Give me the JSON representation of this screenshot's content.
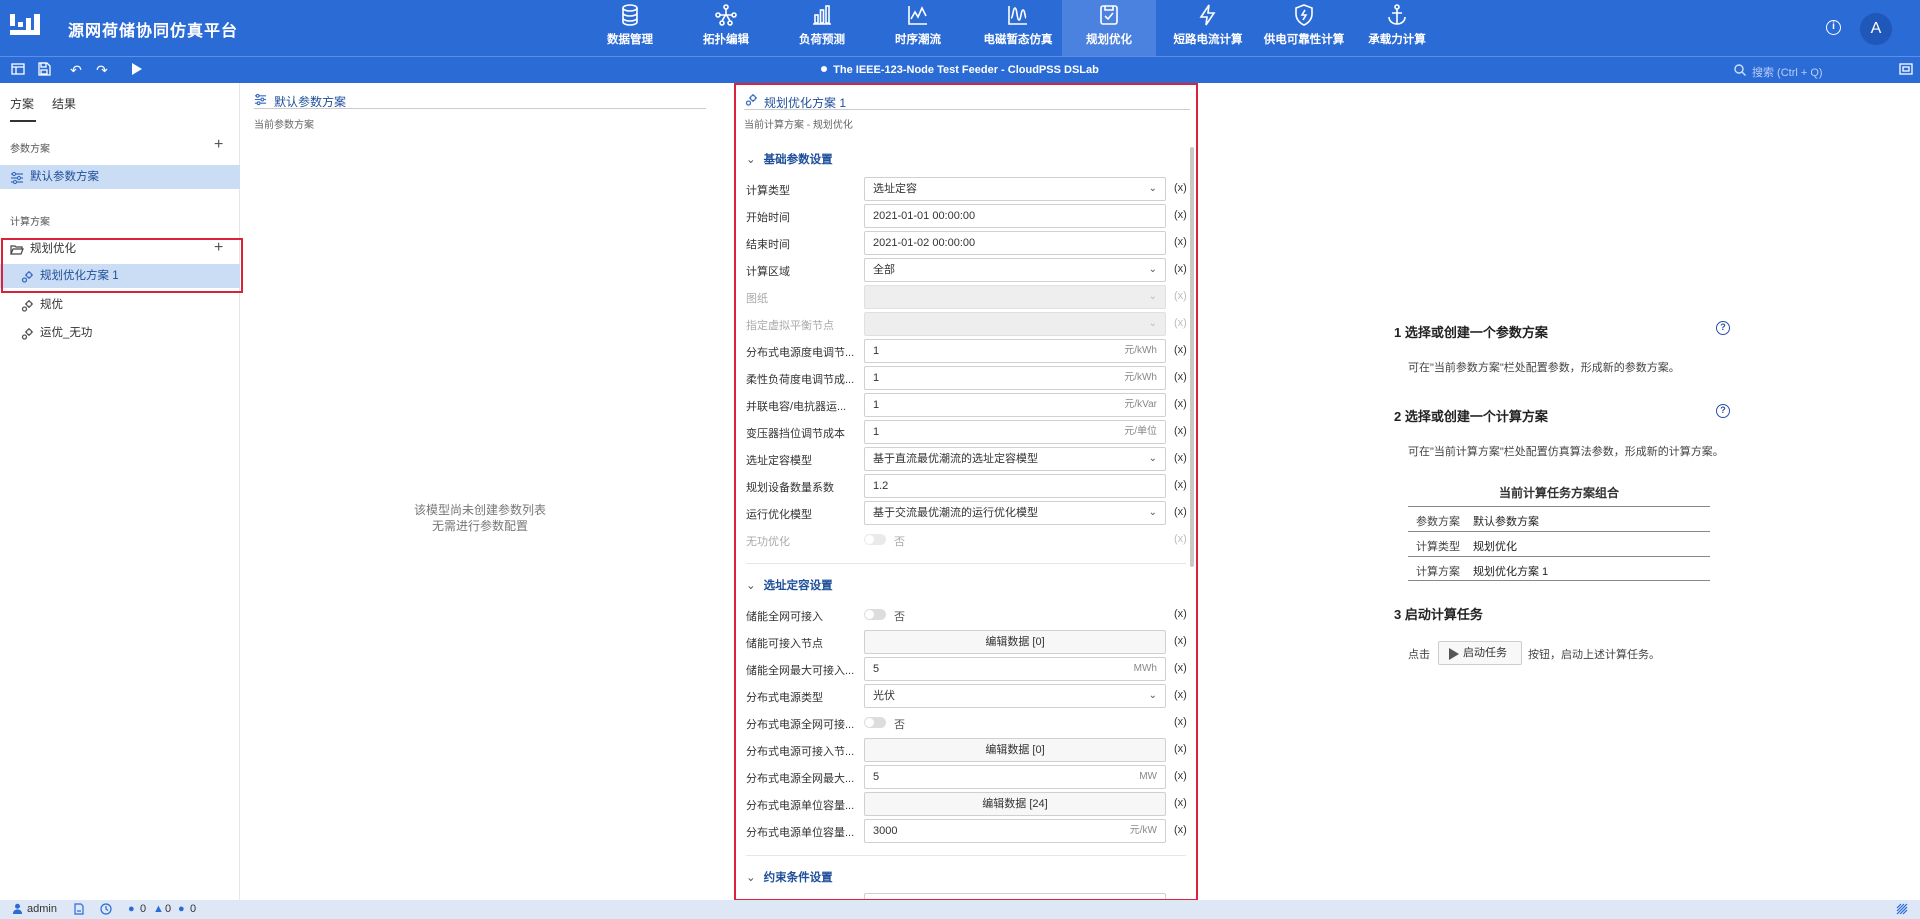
{
  "app": {
    "title": "源网荷储协同仿真平台",
    "avatar": "A",
    "info": "i"
  },
  "nav": [
    {
      "label": "数据管理",
      "icon": "database-icon"
    },
    {
      "label": "拓扑编辑",
      "icon": "topology-icon"
    },
    {
      "label": "负荷预测",
      "icon": "bar-chart-icon"
    },
    {
      "label": "时序潮流",
      "icon": "line-chart-icon"
    },
    {
      "label": "电磁暂态仿真",
      "icon": "wave-icon"
    },
    {
      "label": "规划优化",
      "icon": "planning-icon"
    },
    {
      "label": "短路电流计算",
      "icon": "lightning-icon"
    },
    {
      "label": "供电可靠性计算",
      "icon": "shield-icon"
    },
    {
      "label": "承载力计算",
      "icon": "anchor-icon"
    }
  ],
  "toolbar": {
    "doc_title": "The IEEE-123-Node Test Feeder - CloudPSS DSLab",
    "search_placeholder": "搜索 (Ctrl + Q)"
  },
  "sidebar": {
    "tabs": [
      "方案",
      "结果"
    ],
    "param_section": "参数方案",
    "param_items": [
      "默认参数方案"
    ],
    "calc_section": "计算方案",
    "calc_group": "规划优化",
    "calc_items": [
      "规划优化方案 1",
      "规优",
      "运优_无功"
    ]
  },
  "middle": {
    "title": "默认参数方案",
    "subtitle": "当前参数方案",
    "empty_line1": "该模型尚未创建参数列表",
    "empty_line2": "无需进行参数配置"
  },
  "form": {
    "title": "规划优化方案 1",
    "subtitle": "当前计算方案 - 规划优化",
    "fx": "(x)",
    "groups": [
      "基础参数设置",
      "选址定容设置",
      "约束条件设置"
    ],
    "rows": [
      {
        "label": "计算类型",
        "value": "选址定容",
        "unit": ""
      },
      {
        "label": "开始时间",
        "value": "2021-01-01 00:00:00",
        "unit": ""
      },
      {
        "label": "结束时间",
        "value": "2021-01-02 00:00:00",
        "unit": ""
      },
      {
        "label": "计算区域",
        "value": "全部",
        "unit": ""
      },
      {
        "label": "图纸",
        "value": "",
        "unit": ""
      },
      {
        "label": "指定虚拟平衡节点",
        "value": "",
        "unit": ""
      },
      {
        "label": "分布式电源度电调节...",
        "value": "1",
        "unit": "元/kWh"
      },
      {
        "label": "柔性负荷度电调节成...",
        "value": "1",
        "unit": "元/kWh"
      },
      {
        "label": "并联电容/电抗器运...",
        "value": "1",
        "unit": "元/kVar"
      },
      {
        "label": "变压器挡位调节成本",
        "value": "1",
        "unit": "元/单位"
      },
      {
        "label": "选址定容模型",
        "value": "基于直流最优潮流的选址定容模型",
        "unit": ""
      },
      {
        "label": "规划设备数量系数",
        "value": "1.2",
        "unit": ""
      },
      {
        "label": "运行优化模型",
        "value": "基于交流最优潮流的运行优化模型",
        "unit": ""
      },
      {
        "label": "无功优化",
        "value": "否",
        "unit": ""
      },
      {
        "label": "储能全网可接入",
        "value": "否",
        "unit": ""
      },
      {
        "label": "储能可接入节点",
        "value": "编辑数据 [0]",
        "unit": ""
      },
      {
        "label": "储能全网最大可接入...",
        "value": "5",
        "unit": "MWh"
      },
      {
        "label": "分布式电源类型",
        "value": "光伏",
        "unit": ""
      },
      {
        "label": "分布式电源全网可接...",
        "value": "否",
        "unit": ""
      },
      {
        "label": "分布式电源可接入节...",
        "value": "编辑数据 [0]",
        "unit": ""
      },
      {
        "label": "分布式电源全网最大...",
        "value": "5",
        "unit": "MW"
      },
      {
        "label": "分布式电源单位容量...",
        "value": "编辑数据 [24]",
        "unit": ""
      },
      {
        "label": "分布式电源单位容量...",
        "value": "3000",
        "unit": "元/kW"
      }
    ]
  },
  "guide": {
    "step1_title": "1 选择或创建一个参数方案",
    "step1_text": "可在\"当前参数方案\"栏处配置参数，形成新的参数方案。",
    "step2_title": "2 选择或创建一个计算方案",
    "step2_text": "可在\"当前计算方案\"栏处配置仿真算法参数，形成新的计算方案。",
    "combo_title": "当前计算任务方案组合",
    "combo": [
      {
        "k": "参数方案",
        "v": "默认参数方案"
      },
      {
        "k": "计算类型",
        "v": "规划优化"
      },
      {
        "k": "计算方案",
        "v": "规划优化方案 1"
      }
    ],
    "step3_title": "3 启动计算任务",
    "step3_pre": "点击",
    "start_label": "启动任务",
    "step3_post": "按钮，启动上述计算任务。",
    "qmark": "?"
  },
  "status": {
    "user": "admin",
    "err": "0",
    "warn": "0",
    "info": "0"
  }
}
